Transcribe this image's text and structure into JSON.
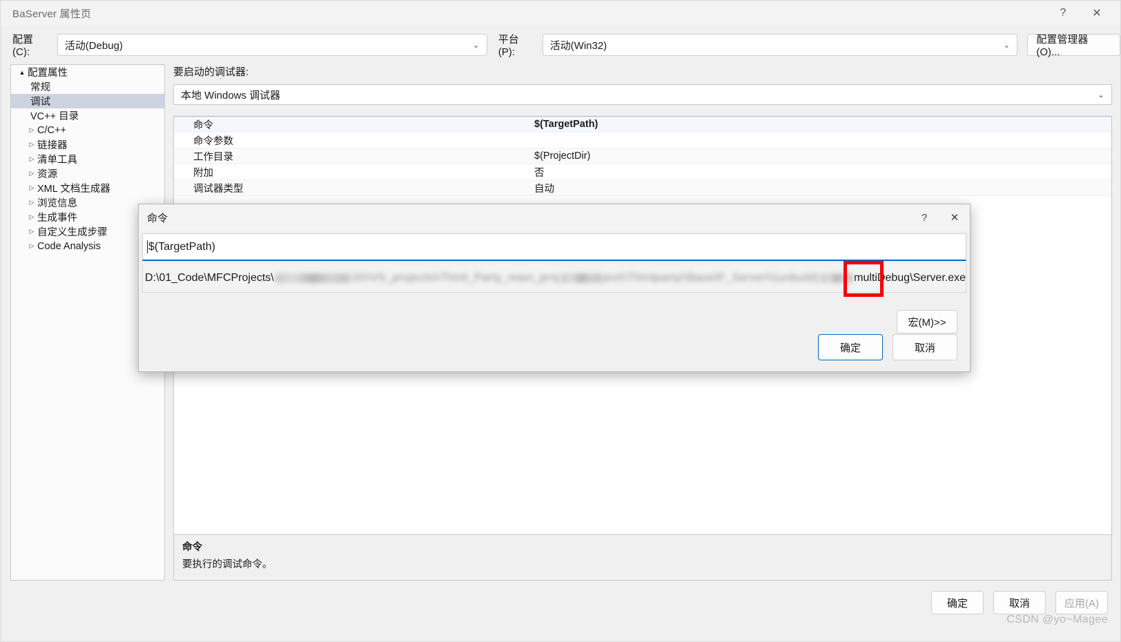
{
  "window": {
    "title": "BaServer 属性页",
    "help_icon": "?",
    "close_icon": "✕"
  },
  "config_bar": {
    "config_label": "配置(C):",
    "config_value": "活动(Debug)",
    "platform_label": "平台(P):",
    "platform_value": "活动(Win32)",
    "config_manager_button": "配置管理器(O)...",
    "chevron_icon": "⌄"
  },
  "tree": {
    "root_label": "配置属性",
    "root_arrow": "▲",
    "items": [
      {
        "label": "常规",
        "arrow": "",
        "selected": false,
        "indent": "lvl2b"
      },
      {
        "label": "调试",
        "arrow": "",
        "selected": true,
        "indent": "lvl2b"
      },
      {
        "label": "VC++ 目录",
        "arrow": "",
        "selected": false,
        "indent": "lvl2b"
      },
      {
        "label": "C/C++",
        "arrow": "▷",
        "selected": false,
        "indent": "lvl2"
      },
      {
        "label": "链接器",
        "arrow": "▷",
        "selected": false,
        "indent": "lvl2"
      },
      {
        "label": "清单工具",
        "arrow": "▷",
        "selected": false,
        "indent": "lvl2"
      },
      {
        "label": "资源",
        "arrow": "▷",
        "selected": false,
        "indent": "lvl2"
      },
      {
        "label": "XML 文档生成器",
        "arrow": "▷",
        "selected": false,
        "indent": "lvl2"
      },
      {
        "label": "浏览信息",
        "arrow": "▷",
        "selected": false,
        "indent": "lvl2"
      },
      {
        "label": "生成事件",
        "arrow": "▷",
        "selected": false,
        "indent": "lvl2"
      },
      {
        "label": "自定义生成步骤",
        "arrow": "▷",
        "selected": false,
        "indent": "lvl2"
      },
      {
        "label": "Code Analysis",
        "arrow": "▷",
        "selected": false,
        "indent": "lvl2"
      }
    ]
  },
  "main": {
    "debugger_caption": "要启动的调试器:",
    "debugger_value": "本地 Windows 调试器",
    "chevron_icon": "⌄",
    "rows": [
      {
        "name": "命令",
        "value": "$(TargetPath)"
      },
      {
        "name": "命令参数",
        "value": ""
      },
      {
        "name": "工作目录",
        "value": "$(ProjectDir)"
      },
      {
        "name": "附加",
        "value": "否"
      },
      {
        "name": "调试器类型",
        "value": "自动"
      }
    ]
  },
  "description": {
    "title": "命令",
    "body": "要执行的调试命令。"
  },
  "footer": {
    "ok": "确定",
    "cancel": "取消",
    "apply": "应用(A)"
  },
  "watermark": "CSDN @yo~Magee",
  "dialog": {
    "title": "命令",
    "help_icon": "?",
    "close_icon": "✕",
    "input_value": "$(TargetPath)",
    "preview_prefix": "D:\\01_Code\\MFCProjects\\",
    "preview_mid": "multi",
    "preview_highlight": "Debug\\",
    "preview_suffix": "Server.exe",
    "macro_button": "宏(M)>>",
    "ok": "确定",
    "cancel": "取消",
    "highlight_color": "#f50000"
  }
}
